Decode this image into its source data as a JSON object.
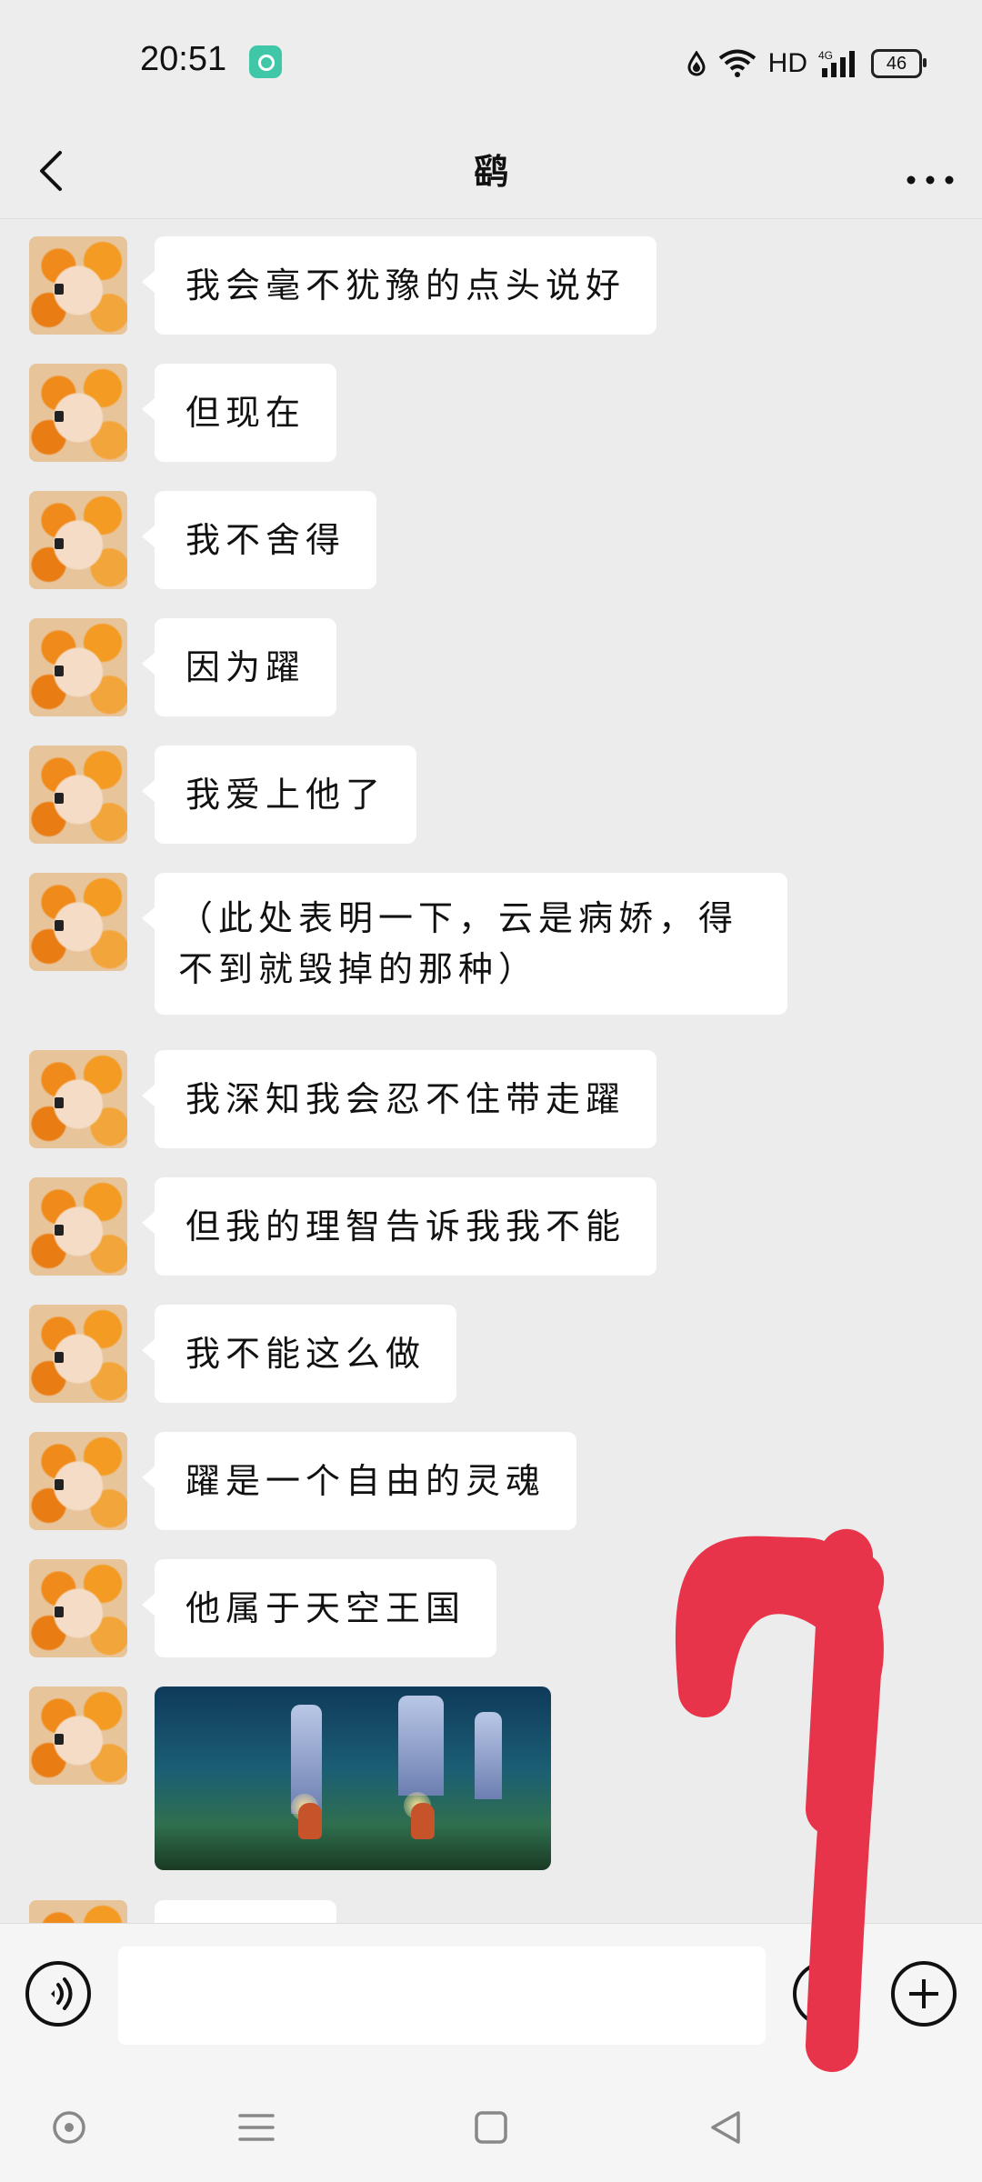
{
  "status_bar": {
    "time": "20:51",
    "network": "HD",
    "battery": "46",
    "icons": [
      "app-notification-icon",
      "data-saver-icon",
      "wifi-icon",
      "cellular-4g-icon",
      "battery-icon"
    ]
  },
  "header": {
    "title": "鹞",
    "back_icon": "chevron-left-icon",
    "more_icon": "more-dots-icon"
  },
  "messages": [
    {
      "type": "text",
      "text": "我会毫不犹豫的点头说好"
    },
    {
      "type": "text",
      "text": "但现在"
    },
    {
      "type": "text",
      "text": "我不舍得"
    },
    {
      "type": "text",
      "text": "因为躍"
    },
    {
      "type": "text",
      "text": "我爱上他了"
    },
    {
      "type": "text",
      "text": "（此处表明一下，云是病娇，得不到就毁掉的那种）"
    },
    {
      "type": "text",
      "text": "我深知我会忍不住带走躍"
    },
    {
      "type": "text",
      "text": "但我的理智告诉我我不能"
    },
    {
      "type": "text",
      "text": "我不能这么做"
    },
    {
      "type": "text",
      "text": "躍是一个自由的灵魂"
    },
    {
      "type": "text",
      "text": "他属于天空王国"
    },
    {
      "type": "image",
      "description_icon": "game-screenshot-image"
    }
  ],
  "input_bar": {
    "value": "",
    "voice_icon": "voice-icon",
    "emoji_icon": "emoji-icon",
    "plus_icon": "plus-icon"
  },
  "nav_bar": {
    "icons": [
      "assistant-icon",
      "menu-icon",
      "home-icon",
      "back-icon"
    ]
  },
  "colors": {
    "background": "#ececec",
    "bubble": "#ffffff",
    "scribble": "#e8344a"
  }
}
